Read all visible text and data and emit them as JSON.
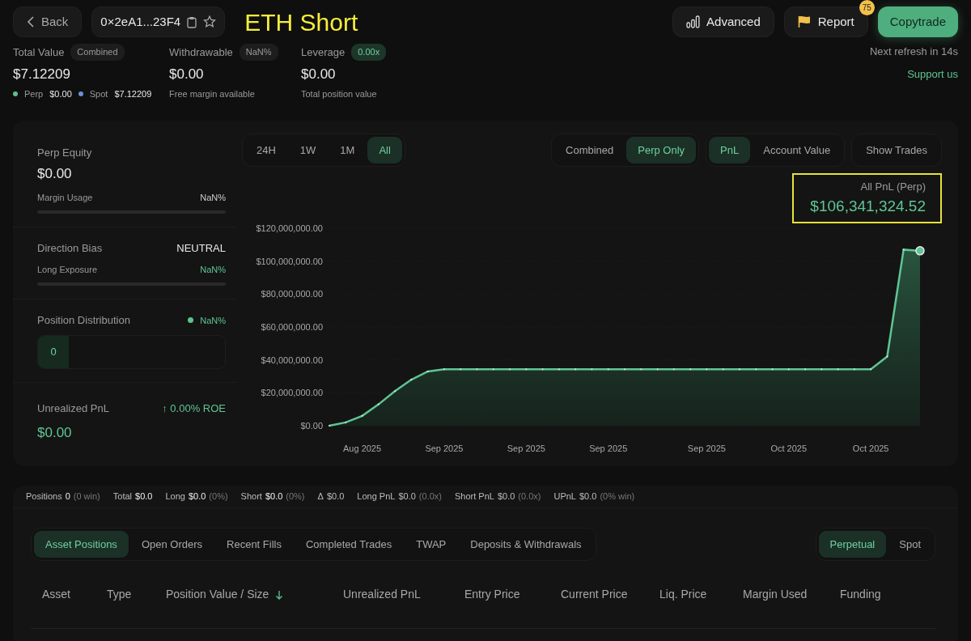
{
  "header": {
    "back_button": {
      "label": "Back"
    },
    "address": {
      "text": "0×2eA1...23F4"
    },
    "annotation_title": "ETH Short",
    "buttons": [
      {
        "kind": "advanced",
        "label": "Advanced"
      },
      {
        "kind": "report",
        "label": "Report",
        "badge": "75"
      },
      {
        "kind": "primary",
        "label": "Copytrade"
      }
    ]
  },
  "stats": [
    {
      "label": "Total Value",
      "tag": {
        "text": "Combined",
        "kind": "neutral"
      },
      "value": "$7.12209",
      "breakdown": [
        {
          "label": "Perp",
          "value": "$0.00",
          "color": "#5fbf8f"
        },
        {
          "label": "Spot",
          "value": "$7.12209",
          "color": "#6b8fd6"
        }
      ]
    },
    {
      "label": "Withdrawable",
      "tag": {
        "text": "NaN%",
        "kind": "neutral"
      },
      "value": "$0.00",
      "note": "Free margin available"
    },
    {
      "label": "Leverage",
      "tag": {
        "text": "0.00x",
        "kind": "positive"
      },
      "value": "$0.00",
      "note": "Total position value"
    }
  ],
  "refresh": "Next refresh in 14s",
  "support_link": "Support us",
  "overview": {
    "perp_equity": {
      "label": "Perp Equity",
      "value": "$0.00",
      "meter": {
        "label": "Margin Usage",
        "reading": "NaN%",
        "level": 0
      }
    },
    "direction_bias": {
      "label": "Direction Bias",
      "value": "NEUTRAL",
      "meter": {
        "label": "Long Exposure",
        "reading": "NaN%",
        "level": 0
      }
    },
    "position_distribution": {
      "label": "Position Distribution",
      "legend": {
        "reading": "NaN%",
        "color": "#5fc28f"
      },
      "segments": [
        {
          "text": "0"
        }
      ]
    },
    "unrealized_pnl": {
      "label": "Unrealized PnL",
      "change": "↑ 0.00% ROE",
      "value": "$0.00"
    }
  },
  "chart_panel": {
    "ranges": [
      {
        "label": "24H",
        "selected": false
      },
      {
        "label": "1W",
        "selected": false
      },
      {
        "label": "1M",
        "selected": false
      },
      {
        "label": "All",
        "selected": true
      }
    ],
    "modes": [
      {
        "label": "Combined",
        "selected": false
      },
      {
        "label": "Perp Only",
        "selected": true
      }
    ],
    "metrics": [
      {
        "label": "PnL",
        "selected": true
      },
      {
        "label": "Account Value",
        "selected": false
      }
    ],
    "show_trades": "Show Trades",
    "highlight": {
      "label": "All PnL (Perp)",
      "value": "$106,341,324.52",
      "annotated": true
    },
    "chart_data": {
      "type": "area",
      "categories": [
        null,
        null,
        "Aug 2025",
        null,
        null,
        null,
        null,
        "Sep 2025",
        null,
        null,
        null,
        null,
        "Sep 2025",
        null,
        null,
        null,
        null,
        "Sep 2025",
        null,
        null,
        null,
        null,
        null,
        "Sep 2025",
        null,
        null,
        null,
        null,
        "Oct 2025",
        null,
        null,
        null,
        null,
        "Oct 2025",
        null,
        null,
        null
      ],
      "series": [
        {
          "color": "#5fc593",
          "values": [
            0,
            2000000,
            6000000,
            13000000,
            21000000,
            28000000,
            33000000,
            34300000,
            34300000,
            34300000,
            34300000,
            34300000,
            34300000,
            34300000,
            34300000,
            34300000,
            34300000,
            34300000,
            34300000,
            34300000,
            34300000,
            34300000,
            34300000,
            34300000,
            34300000,
            34300000,
            34300000,
            34300000,
            34300000,
            34300000,
            34300000,
            34300000,
            34300000,
            34300000,
            42000000,
            107000000,
            106300000
          ]
        }
      ],
      "ylim": [
        0,
        120000000
      ],
      "yticks": [
        {
          "value": 0,
          "label": "$0.00"
        },
        {
          "value": 20000000,
          "label": "$20,000,000.00"
        },
        {
          "value": 40000000,
          "label": "$40,000,000.00"
        },
        {
          "value": 60000000,
          "label": "$60,000,000.00"
        },
        {
          "value": 80000000,
          "label": "$80,000,000.00"
        },
        {
          "value": 100000000,
          "label": "$100,000,000.00"
        },
        {
          "value": 120000000,
          "label": "$120,000,000.00"
        }
      ]
    }
  },
  "summary": [
    {
      "label": "Positions",
      "value": "0",
      "note": "(0 win)",
      "positive": false
    },
    {
      "label": "Total",
      "value": "$0.0",
      "positive": false
    },
    {
      "label": "Long",
      "value": "$0.0",
      "note": "(0%)",
      "positive": false
    },
    {
      "label": "Short",
      "value": "$0.0",
      "note": "(0%)",
      "positive": false
    },
    {
      "label": "Δ",
      "value": "$0.0",
      "positive": true
    },
    {
      "label": "Long PnL",
      "value": "$0.0",
      "note": "(0.0x)",
      "positive": true
    },
    {
      "label": "Short PnL",
      "value": "$0.0",
      "note": "(0.0x)",
      "positive": true
    },
    {
      "label": "UPnL",
      "value": "$0.0",
      "note": "(0% win)",
      "positive": true
    }
  ],
  "tabs": [
    {
      "label": "Asset Positions",
      "selected": true
    },
    {
      "label": "Open Orders",
      "selected": false
    },
    {
      "label": "Recent Fills",
      "selected": false
    },
    {
      "label": "Completed Trades",
      "selected": false
    },
    {
      "label": "TWAP",
      "selected": false
    },
    {
      "label": "Deposits & Withdrawals",
      "selected": false
    }
  ],
  "market_tabs": [
    {
      "label": "Perpetual",
      "selected": true
    },
    {
      "label": "Spot",
      "selected": false
    }
  ],
  "table": {
    "columns": [
      {
        "label": "Asset"
      },
      {
        "label": "Type"
      },
      {
        "label": "Position Value / Size",
        "sorted": true
      },
      {
        "label": "Unrealized PnL"
      },
      {
        "label": "Entry Price"
      },
      {
        "label": "Current Price"
      },
      {
        "label": "Liq. Price"
      },
      {
        "label": "Margin Used"
      },
      {
        "label": "Funding"
      }
    ]
  }
}
